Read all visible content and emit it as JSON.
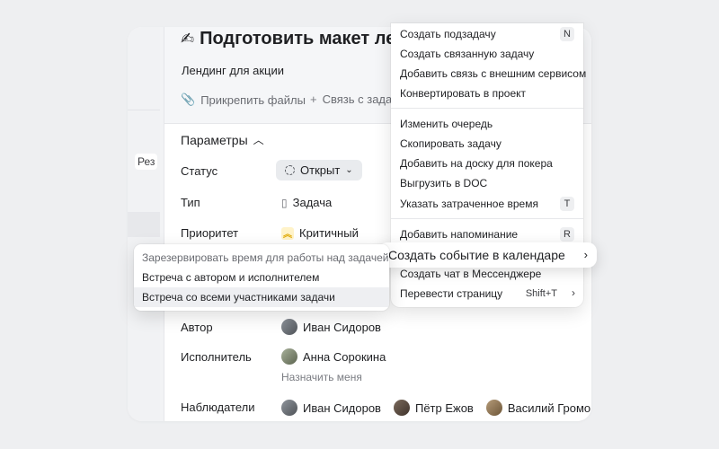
{
  "task": {
    "title": "Подготовить макет ле",
    "subtitle": "Лендинг для акции",
    "attach_label": "Прикрепить файлы",
    "link_label": "Связь с задаче"
  },
  "left_strip": {
    "rez_label": "Рез"
  },
  "params": {
    "heading": "Параметры",
    "status_label": "Статус",
    "status_value": "Открыт",
    "type_label": "Тип",
    "type_value": "Задача",
    "priority_label": "Приоритет",
    "priority_value": "Критичный",
    "author_label": "Автор",
    "author_value": "Иван Сидоров",
    "assignee_label": "Исполнитель",
    "assignee_value": "Анна Сорокина",
    "assign_me": "Назначить меня",
    "watchers_label": "Наблюдатели",
    "watchers": [
      "Иван Сидоров",
      "Пётр Ежов",
      "Василий Громов"
    ]
  },
  "menu": {
    "items": [
      {
        "label": "Создать подзадачу",
        "shortcut": "N"
      },
      {
        "label": "Создать связанную задачу",
        "shortcut": ""
      },
      {
        "label": "Добавить связь с внешним сервисом",
        "shortcut": ""
      },
      {
        "label": "Конвертировать в проект",
        "shortcut": ""
      },
      {
        "label": "Изменить очередь",
        "shortcut": ""
      },
      {
        "label": "Скопировать задачу",
        "shortcut": ""
      },
      {
        "label": "Добавить на доску для покера",
        "shortcut": ""
      },
      {
        "label": "Выгрузить в DOC",
        "shortcut": ""
      },
      {
        "label": "Указать затраченное время",
        "shortcut": "T"
      },
      {
        "label": "Добавить напоминание",
        "shortcut": "R"
      },
      {
        "label": "Создать событие в календаре",
        "shortcut": ""
      },
      {
        "label": "Создать чат в Мессенджере",
        "shortcut": ""
      },
      {
        "label": "Перевести страницу",
        "shortcut": "Shift+T"
      }
    ]
  },
  "submenu": {
    "header": "Зарезервировать время для работы над задачей",
    "items": [
      "Встреча с автором и исполнителем",
      "Встреча со всеми участниками задачи"
    ]
  }
}
